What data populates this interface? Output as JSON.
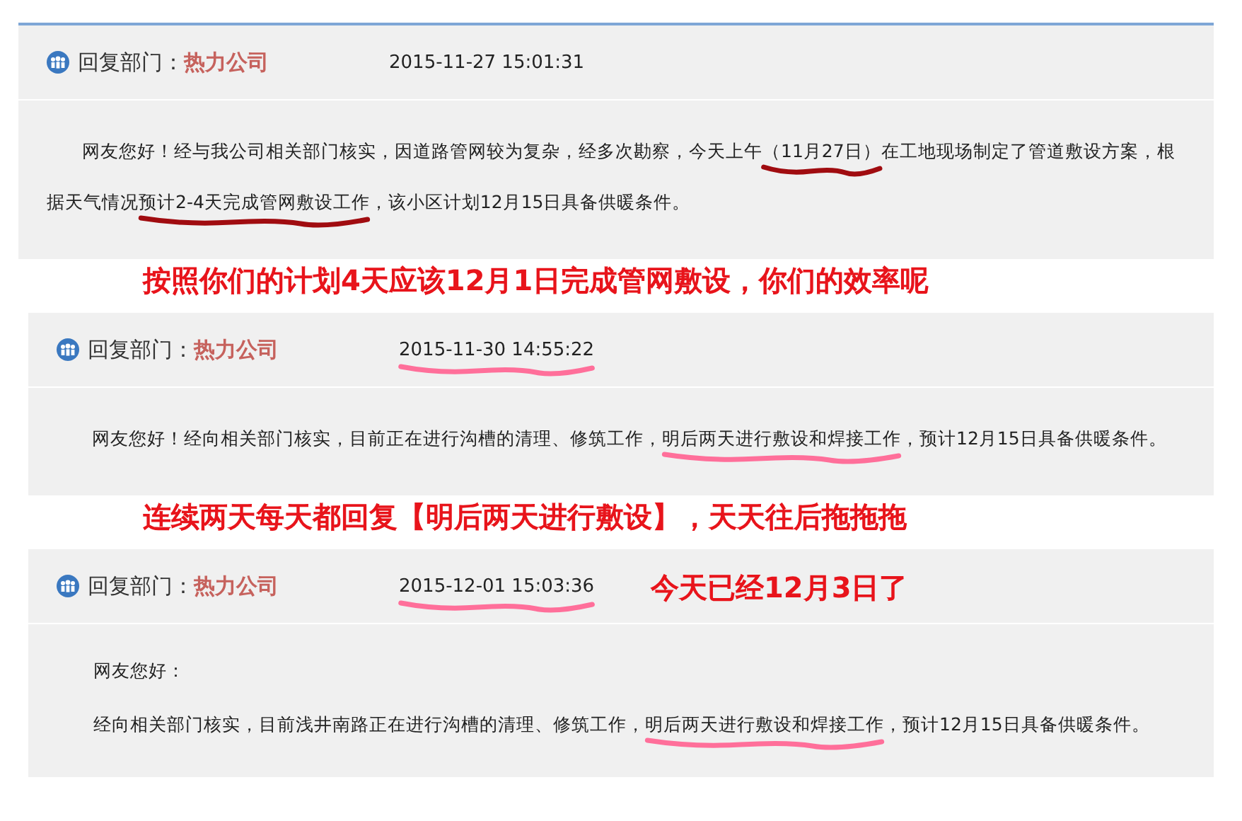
{
  "replies": [
    {
      "label": "回复部门：",
      "department": "热力公司",
      "time": {
        "text": "2015-11-27 15:01:31",
        "underlined": false
      },
      "indented": true,
      "paragraphs": [
        [
          {
            "text": "网友您好！经与我公司相关部门核实，因道路管网较为复杂，经多次勘察，今天上午",
            "underlined": false
          },
          {
            "text": "（11月27日）",
            "underlined": true,
            "color": "#a00c10"
          },
          {
            "text": "在工地现场制定了管道敷设方案，根据天气情况",
            "underlined": false
          },
          {
            "text": "预计2-4天完成管网敷设工作",
            "underlined": true,
            "color": "#a00c10"
          },
          {
            "text": "，该小区计划12月15日具备供暖条件。",
            "underlined": false
          }
        ]
      ],
      "note_below": "按照你们的计划4天应该12月1日完成管网敷设，你们的效率呢"
    },
    {
      "label": "回复部门：",
      "department": "热力公司",
      "time": {
        "text": "2015-11-30 14:55:22",
        "underlined": true,
        "color": "#ff6f9a"
      },
      "indented": true,
      "paragraphs": [
        [
          {
            "text": "网友您好！经向相关部门核实，目前正在进行沟槽的清理、修筑工作，",
            "underlined": false
          },
          {
            "text": "明后两天进行敷设和焊接工作",
            "underlined": true,
            "color": "#ff6f9a"
          },
          {
            "text": "，预计12月15日具备供暖条件。",
            "underlined": false
          }
        ]
      ],
      "note_below": "连续两天每天都回复【明后两天进行敷设】，天天往后拖拖拖"
    },
    {
      "label": "回复部门：",
      "department": "热力公司",
      "time": {
        "text": "2015-12-01 15:03:36",
        "underlined": true,
        "color": "#ff6f9a"
      },
      "indented": false,
      "paragraphs": [
        [
          {
            "text": "网友您好：",
            "underlined": false
          }
        ],
        [
          {
            "text": "经向相关部门核实，目前浅井南路正在进行沟槽的清理、修筑工作，",
            "underlined": false
          },
          {
            "text": "明后两天进行敷设和焊接工作",
            "underlined": true,
            "color": "#ff6f9a"
          },
          {
            "text": "，预计12月15日具备供暖条件。",
            "underlined": false
          }
        ]
      ],
      "note_beside": "今天已经12月3日了"
    }
  ]
}
